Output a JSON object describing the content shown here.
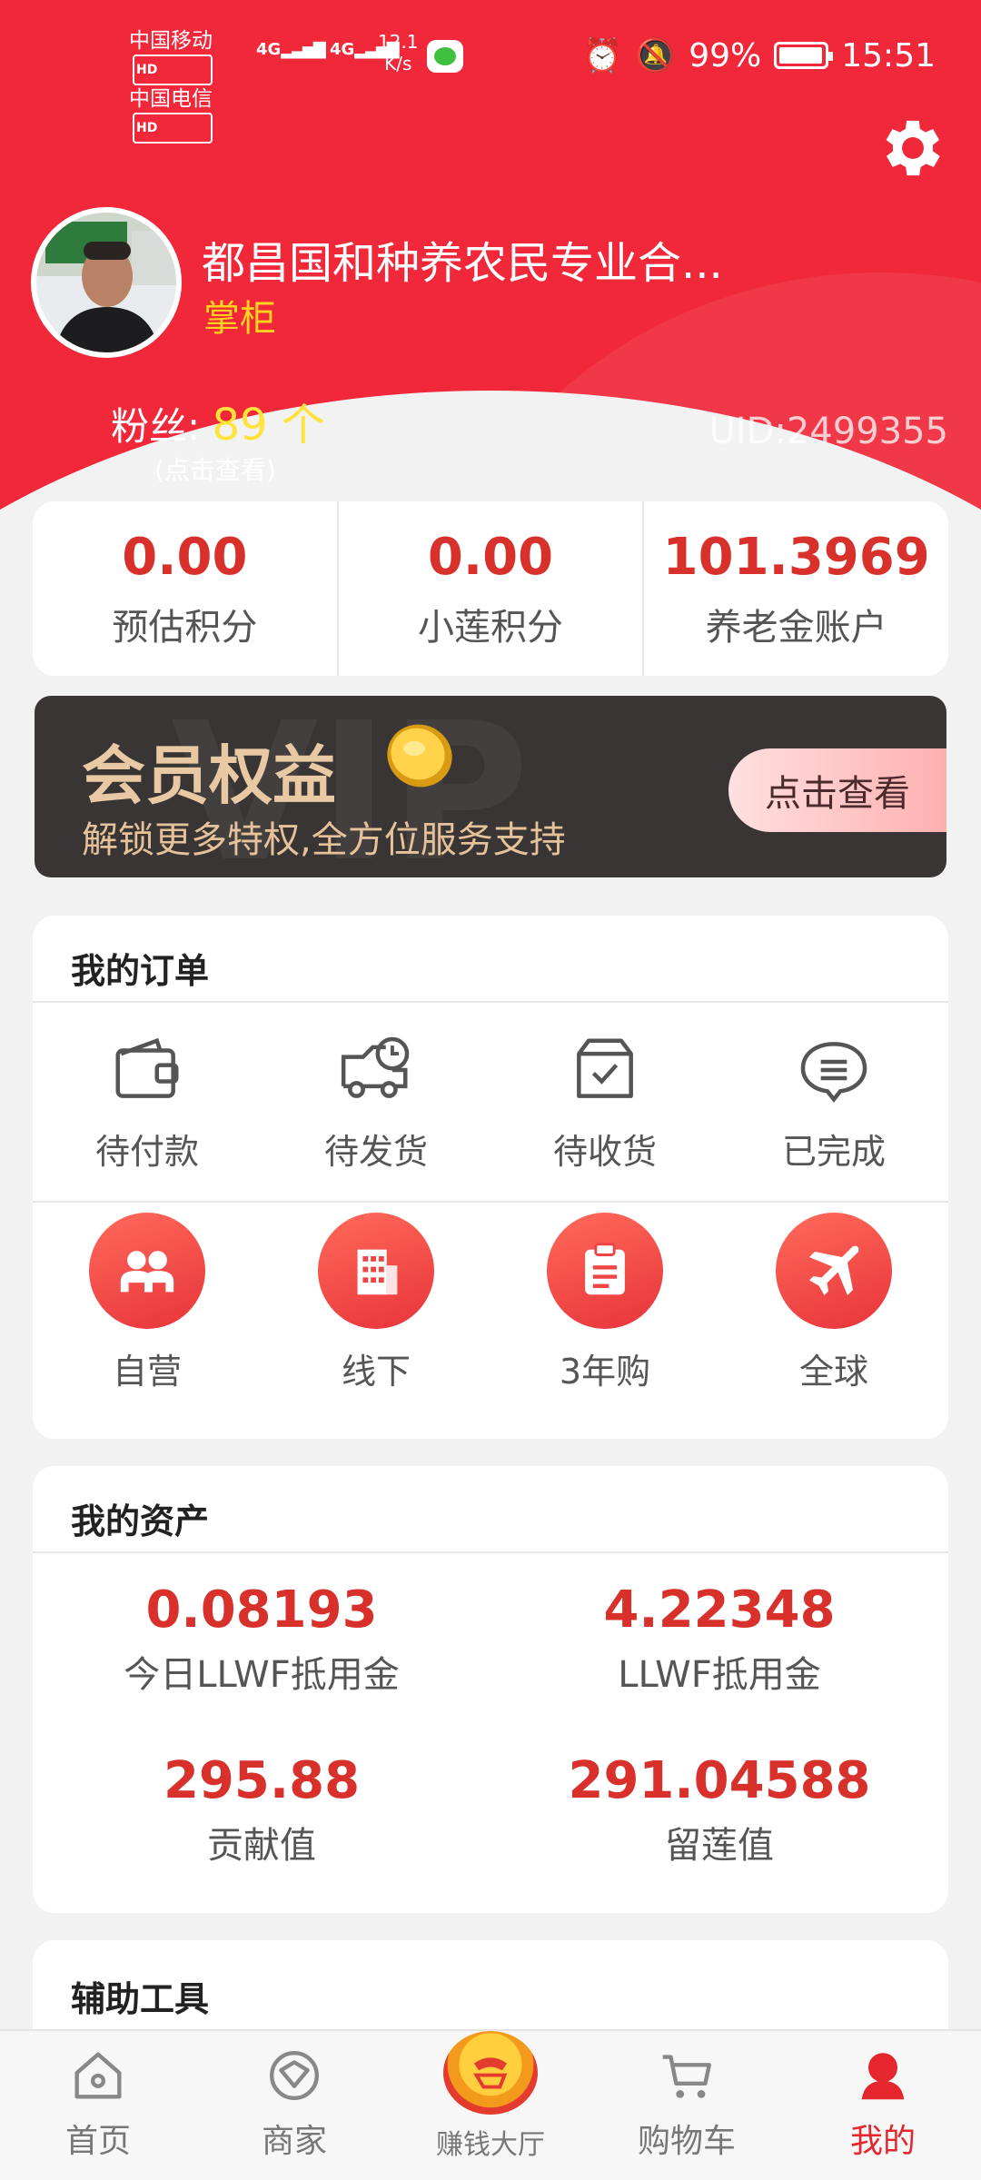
{
  "status_bar": {
    "carrier1": "中国移动",
    "carrier2": "中国电信",
    "hd": "HD",
    "net1": "4G",
    "net2": "4G",
    "speed_value": "12.1",
    "speed_unit": "K/s",
    "battery": "99%",
    "time": "15:51"
  },
  "profile": {
    "name": "都昌国和种养农民专业合...",
    "role": "掌柜",
    "fans_label": "粉丝:",
    "fans_count": "89 个",
    "fans_hint": "(点击查看)",
    "uid": "UID:2499355"
  },
  "points": [
    {
      "value": "0.00",
      "label": "预估积分"
    },
    {
      "value": "0.00",
      "label": "小莲积分"
    },
    {
      "value": "101.3969",
      "label": "养老金账户"
    }
  ],
  "vip_banner": {
    "title": "会员权益",
    "subtitle": "解锁更多特权,全方位服务支持",
    "button": "点击查看",
    "watermark": "VIP"
  },
  "orders": {
    "title": "我的订单",
    "status_items": [
      {
        "label": "待付款",
        "icon": "wallet-icon"
      },
      {
        "label": "待发货",
        "icon": "delivery-truck-icon"
      },
      {
        "label": "待收货",
        "icon": "package-check-icon"
      },
      {
        "label": "已完成",
        "icon": "chat-bubble-icon"
      }
    ],
    "channel_items": [
      {
        "label": "自营",
        "icon": "users-icon"
      },
      {
        "label": "线下",
        "icon": "building-icon"
      },
      {
        "label": "3年购",
        "icon": "clipboard-icon"
      },
      {
        "label": "全球",
        "icon": "airplane-icon"
      }
    ]
  },
  "assets": {
    "title": "我的资产",
    "items": [
      {
        "value": "0.08193",
        "label": "今日LLWF抵用金"
      },
      {
        "value": "4.22348",
        "label": "LLWF抵用金"
      },
      {
        "value": "295.88",
        "label": "贡献值"
      },
      {
        "value": "291.04588",
        "label": "留莲值"
      }
    ]
  },
  "tools": {
    "title": "辅助工具"
  },
  "tabbar": [
    {
      "label": "首页",
      "icon": "home-icon"
    },
    {
      "label": "商家",
      "icon": "shop-icon"
    },
    {
      "label": "赚钱大厅",
      "icon": "earn-hall-icon"
    },
    {
      "label": "购物车",
      "icon": "cart-icon"
    },
    {
      "label": "我的",
      "icon": "user-icon",
      "active": true
    }
  ],
  "colors": {
    "brand_red": "#f0283a",
    "value_red": "#d8302a",
    "fans_yellow": "#ffe23a",
    "role_yellow": "#ffd21e",
    "vip_gold": "#e9c9a3"
  }
}
